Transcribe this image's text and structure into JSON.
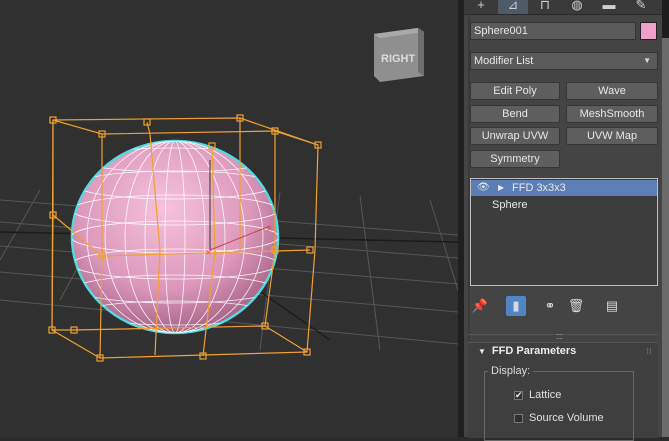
{
  "viewport": {
    "viewcube_label": "RIGHT",
    "colors": {
      "background": "#303030",
      "grid": "#555555",
      "sphere": "#e9a7c8",
      "wire": "#ffffff",
      "lattice": "#f0a030",
      "selection": "#55d8e0"
    }
  },
  "command_panel": {
    "tabs": [
      "create-icon",
      "modify-icon",
      "hierarchy-icon",
      "motion-icon",
      "display-icon",
      "utilities-icon"
    ],
    "object_name": "Sphere001",
    "object_color": "#f0a0c8",
    "modifier_list_label": "Modifier List",
    "modifier_buttons": [
      {
        "label": "Edit Poly"
      },
      {
        "label": "Wave"
      },
      {
        "label": "Bend"
      },
      {
        "label": "MeshSmooth"
      },
      {
        "label": "Unwrap UVW"
      },
      {
        "label": "UVW Map"
      },
      {
        "label": "Symmetry"
      }
    ],
    "stack": [
      {
        "label": "FFD 3x3x3",
        "selected": true
      },
      {
        "label": "Sphere",
        "selected": false
      }
    ],
    "stack_tools": [
      "pin-stack-icon",
      "show-end-result-icon",
      "make-unique-icon",
      "remove-modifier-icon",
      "configure-modifier-sets-icon"
    ],
    "rollout": {
      "title": "FFD Parameters",
      "display_group_label": "Display:",
      "checkboxes": [
        {
          "label": "Lattice",
          "checked": true
        },
        {
          "label": "Source Volume",
          "checked": false
        }
      ]
    }
  }
}
